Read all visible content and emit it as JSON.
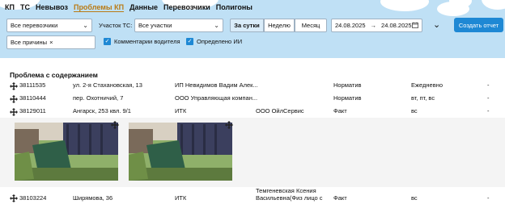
{
  "nav": {
    "items": [
      "КП",
      "ТС",
      "Невывоз",
      "Проблемы КП",
      "Данные",
      "Перевозчики",
      "Полигоны"
    ],
    "active_index": 3
  },
  "filters": {
    "carrier": "Все перевозчики",
    "section_label": "Участок ТС:",
    "section": "Все участки",
    "periods": [
      "За сутки",
      "Неделю",
      "Месяц"
    ],
    "active_period": 0,
    "date_from": "24.08.2025",
    "date_arrow": "→",
    "date_to": "24.08.2025",
    "report_button": "Создать отчет",
    "reasons_tag": "Все причины",
    "reasons_tag_close": "×",
    "driver_comments": "Комментарии водителя",
    "ai_detected": "Определено ИИ",
    "check_mark": "✓"
  },
  "table": {
    "section_title": "Проблема с содержанием",
    "rows": [
      {
        "id": "38111535",
        "address": "ул. 2-я Стахановская, 13",
        "owner": "ИП Невидимов Вадим Алек...",
        "carrier": "",
        "type": "Норматив",
        "schedule": "Ежедневно",
        "extra": "-"
      },
      {
        "id": "38110444",
        "address": "пер. Охотничий, 7",
        "owner": "ООО Управляющая компан...",
        "carrier": "",
        "type": "Норматив",
        "schedule": "вт, пт, вс",
        "extra": "-"
      },
      {
        "id": "38129011",
        "address": "Ангарск, 253 квл. 9/1",
        "owner": "ИТК",
        "carrier": "ООО ОйлСервис",
        "type": "Факт",
        "schedule": "вс",
        "extra": "-"
      },
      {
        "id": "38103224",
        "address": "Ширямова, 36",
        "owner": "ИТК",
        "carrier_line1": "Темгеневская Ксения",
        "carrier_line2": "Васильевна(Физ лицо с",
        "type": "Факт",
        "schedule": "вс",
        "extra": "-"
      }
    ]
  },
  "colors": {
    "accent": "#1e88d4",
    "nav_active": "#b97a14",
    "header_bg": "#bfe0f5"
  },
  "icons": [
    "move-icon",
    "calendar-icon",
    "chevron-down-icon",
    "close-icon",
    "checkbox-checked-icon"
  ]
}
